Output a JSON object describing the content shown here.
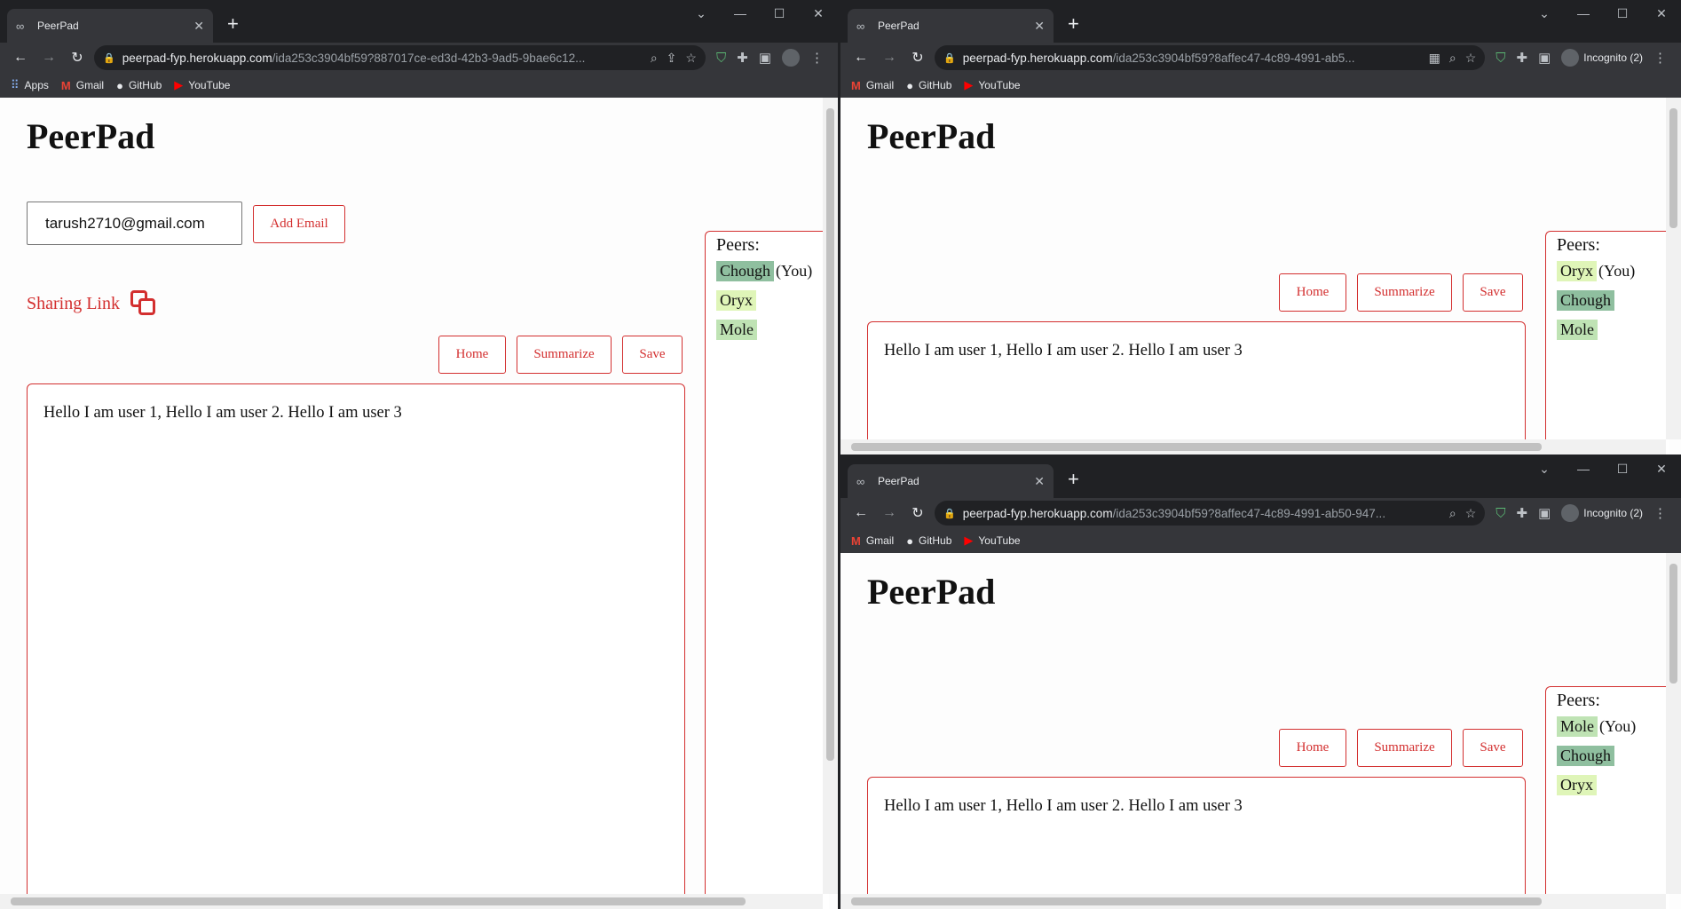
{
  "windows": [
    {
      "tab_title": "PeerPad",
      "url_host": "peerpad-fyp.herokuapp.com",
      "url_path": "/ida253c3904bf59?887017ce-ed3d-42b3-9ad5-9bae6c12...",
      "bookmarks": [
        "Apps",
        "Gmail",
        "GitHub",
        "YouTube"
      ],
      "logo": "PeerPad",
      "email_value": "tarush2710@gmail.com",
      "add_email_label": "Add Email",
      "sharing_label": "Sharing Link",
      "home_label": "Home",
      "summarize_label": "Summarize",
      "save_label": "Save",
      "editor_text": "Hello I am user 1, Hello I am user 2. Hello I am user 3",
      "peers_title": "Peers:",
      "peers": [
        {
          "name": "Chough",
          "you": "(You)",
          "color": "dark"
        },
        {
          "name": "Oryx",
          "you": "",
          "color": "yellowg"
        },
        {
          "name": "Mole",
          "you": "",
          "color": "lightgreen"
        }
      ]
    },
    {
      "tab_title": "PeerPad",
      "url_host": "peerpad-fyp.herokuapp.com",
      "url_path": "/ida253c3904bf59?8affec47-4c89-4991-ab5...",
      "bookmarks": [
        "Gmail",
        "GitHub",
        "YouTube"
      ],
      "profile_label": "Incognito (2)",
      "logo": "PeerPad",
      "home_label": "Home",
      "summarize_label": "Summarize",
      "save_label": "Save",
      "editor_text": "Hello I am user 1, Hello I am user 2. Hello I am user 3",
      "peers_title": "Peers:",
      "peers": [
        {
          "name": "Oryx",
          "you": "(You)",
          "color": "yellowg"
        },
        {
          "name": "Chough",
          "you": "",
          "color": "dark"
        },
        {
          "name": "Mole",
          "you": "",
          "color": "lightgreen"
        }
      ]
    },
    {
      "tab_title": "PeerPad",
      "url_host": "peerpad-fyp.herokuapp.com",
      "url_path": "/ida253c3904bf59?8affec47-4c89-4991-ab50-947...",
      "bookmarks": [
        "Gmail",
        "GitHub",
        "YouTube"
      ],
      "profile_label": "Incognito (2)",
      "logo": "PeerPad",
      "home_label": "Home",
      "summarize_label": "Summarize",
      "save_label": "Save",
      "editor_text": "Hello I am user 1, Hello I am user 2. Hello I am user 3",
      "peers_title": "Peers:",
      "peers": [
        {
          "name": "Mole",
          "you": "(You)",
          "color": "lightgreen"
        },
        {
          "name": "Chough",
          "you": "",
          "color": "dark"
        },
        {
          "name": "Oryx",
          "you": "",
          "color": "yellowg"
        }
      ]
    }
  ]
}
